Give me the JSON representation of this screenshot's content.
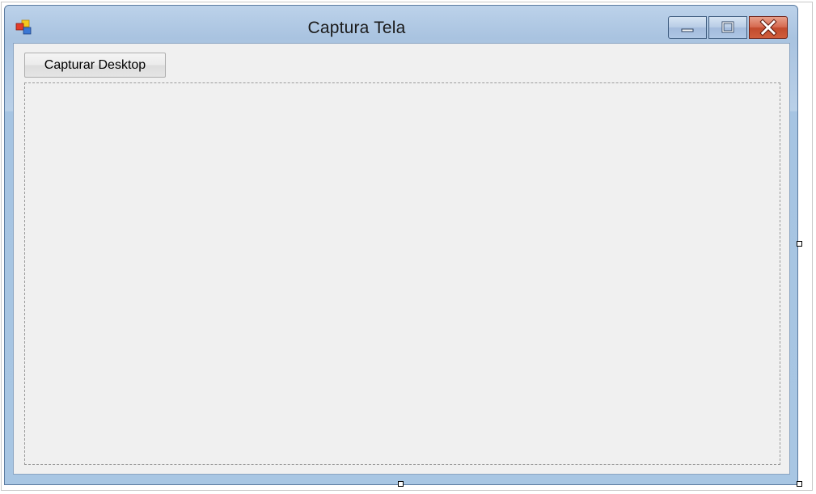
{
  "window": {
    "title": "Captura Tela",
    "icon": "windows-form-icon"
  },
  "caption_buttons": {
    "minimize": "minimize-icon",
    "maximize": "maximize-icon",
    "close": "close-icon"
  },
  "form": {
    "capture_button_label": "Capturar Desktop",
    "picture_box": "empty"
  },
  "colors": {
    "titlebar": "#a9c3e0",
    "client_background": "#f0f0f0",
    "close_button": "#c24a2d"
  }
}
